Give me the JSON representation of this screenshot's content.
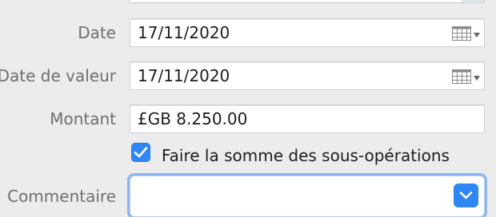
{
  "form": {
    "date_label": "Date",
    "date_value": "17/11/2020",
    "value_date_label": "Date de valeur",
    "value_date_value": "17/11/2020",
    "amount_label": "Montant",
    "amount_value": "£GB 8.250.00",
    "sum_checkbox_label": "Faire la somme des sous-opérations",
    "sum_checkbox_checked": true,
    "comment_label": "Commentaire",
    "comment_value": ""
  },
  "icons": {
    "calendar": "calendar-grid-icon",
    "dropdown_caret": "chevron-down-icon",
    "checkmark": "checkmark-icon"
  },
  "colors": {
    "accent": "#2f86f5",
    "background": "#ececec",
    "label": "#6f6f6f"
  }
}
